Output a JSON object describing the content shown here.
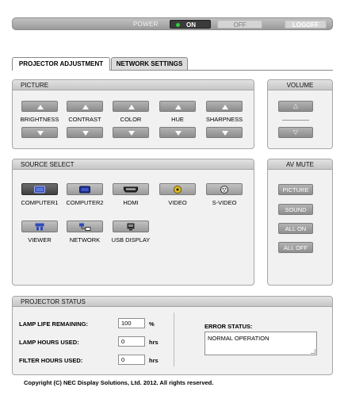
{
  "topbar": {
    "power_label": "POWER",
    "on_label": "ON",
    "off_label": "OFF",
    "logoff_label": "LOGOFF",
    "led_color": "#2fd038"
  },
  "tabs": [
    {
      "label": "PROJECTOR ADJUSTMENT",
      "active": true
    },
    {
      "label": "NETWORK SETTINGS",
      "active": false
    }
  ],
  "picture": {
    "title": "PICTURE",
    "controls": [
      {
        "label": "BRIGHTNESS"
      },
      {
        "label": "CONTRAST"
      },
      {
        "label": "COLOR"
      },
      {
        "label": "HUE"
      },
      {
        "label": "SHARPNESS"
      }
    ]
  },
  "volume": {
    "title": "VOLUME"
  },
  "source_select": {
    "title": "SOURCE SELECT",
    "sources": [
      {
        "label": "COMPUTER1",
        "icon": "computer-icon",
        "selected": true
      },
      {
        "label": "COMPUTER2",
        "icon": "computer-icon",
        "selected": false
      },
      {
        "label": "HDMI",
        "icon": "hdmi-icon",
        "selected": false
      },
      {
        "label": "VIDEO",
        "icon": "video-icon",
        "selected": false
      },
      {
        "label": "S-VIDEO",
        "icon": "svideo-icon",
        "selected": false
      },
      {
        "label": "VIEWER",
        "icon": "viewer-icon",
        "selected": false
      },
      {
        "label": "NETWORK",
        "icon": "network-icon",
        "selected": false
      },
      {
        "label": "USB DISPLAY",
        "icon": "usb-display-icon",
        "selected": false
      }
    ]
  },
  "av_mute": {
    "title": "AV MUTE",
    "buttons": [
      {
        "label": "PICTURE"
      },
      {
        "label": "SOUND"
      },
      {
        "label": "ALL ON"
      },
      {
        "label": "ALL OFF"
      }
    ]
  },
  "status": {
    "title": "PROJECTOR STATUS",
    "lamp_life_label": "LAMP LIFE REMAINING:",
    "lamp_life_value": "100",
    "lamp_life_unit": "%",
    "lamp_hours_label": "LAMP HOURS USED:",
    "lamp_hours_value": "0",
    "lamp_hours_unit": "hrs",
    "filter_hours_label": "FILTER HOURS USED:",
    "filter_hours_value": "0",
    "filter_hours_unit": "hrs",
    "error_label": "ERROR STATUS:",
    "error_value": "NORMAL OPERATION"
  },
  "footer": {
    "copyright": "Copyright (C) NEC Display Solutions, Ltd. 2012. All rights reserved."
  }
}
